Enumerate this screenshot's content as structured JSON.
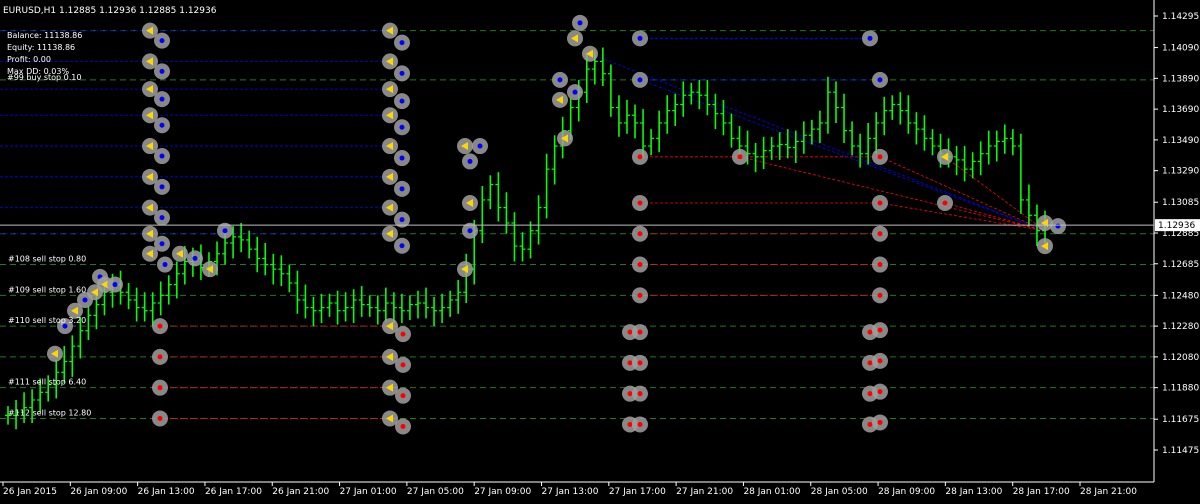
{
  "header": {
    "symbol": "EURUSD,H1",
    "quote": "1.12885 1.12936 1.12885 1.12936"
  },
  "account": {
    "balance": "Balance: 11138.86",
    "equity": "Equity: 11138.86",
    "profit": "Profit: 0.00",
    "max_dd": "Max DD: 0.03%",
    "order_note": "#99 buy stop 0.10"
  },
  "colors": {
    "background": "#000000",
    "candle": "#00ff00",
    "buy": "#0000ff",
    "sell": "#ff0000",
    "level_line": "#1e7a1e",
    "bid_line": "#c0c0c0",
    "marker_ring": "#a0a0a0",
    "axis_text": "#ffffff"
  },
  "chart_data": {
    "type": "candlestick",
    "symbol": "EURUSD",
    "timeframe": "H1",
    "current_price": 1.12936,
    "current_price_label": "1.12936",
    "ylim": [
      1.11475,
      1.14295
    ],
    "y_ticks": [
      "1.14295",
      "1.14090",
      "1.13890",
      "1.13690",
      "1.13490",
      "1.13290",
      "1.13085",
      "1.12885",
      "1.12685",
      "1.12480",
      "1.12280",
      "1.12080",
      "1.11880",
      "1.11675",
      "1.11475"
    ],
    "x_ticks": [
      "26 Jan 2015",
      "26 Jan 09:00",
      "26 Jan 13:00",
      "26 Jan 17:00",
      "26 Jan 21:00",
      "27 Jan 01:00",
      "27 Jan 05:00",
      "27 Jan 09:00",
      "27 Jan 13:00",
      "27 Jan 17:00",
      "27 Jan 21:00",
      "28 Jan 01:00",
      "28 Jan 05:00",
      "28 Jan 09:00",
      "28 Jan 13:00",
      "28 Jan 17:00",
      "28 Jan 21:00"
    ],
    "grid_levels": [
      1.142,
      1.1388,
      1.1288,
      1.1268,
      1.1248,
      1.1228,
      1.1208,
      1.1188,
      1.1168
    ],
    "candles_close": [
      1.117,
      1.1172,
      1.1175,
      1.118,
      1.1185,
      1.119,
      1.1198,
      1.1205,
      1.1215,
      1.1225,
      1.1235,
      1.1242,
      1.125,
      1.1255,
      1.125,
      1.1245,
      1.124,
      1.1238,
      1.1243,
      1.1248,
      1.1255,
      1.1262,
      1.127,
      1.1272,
      1.1266,
      1.127,
      1.1275,
      1.1282,
      1.1286,
      1.1284,
      1.1278,
      1.1272,
      1.1268,
      1.1265,
      1.1262,
      1.1256,
      1.1245,
      1.124,
      1.1238,
      1.124,
      1.1243,
      1.1238,
      1.124,
      1.1245,
      1.1242,
      1.124,
      1.1238,
      1.1243,
      1.124,
      1.1238,
      1.1242,
      1.1243,
      1.124,
      1.1238,
      1.124,
      1.1245,
      1.125,
      1.1265,
      1.129,
      1.131,
      1.132,
      1.1305,
      1.1295,
      1.128,
      1.1278,
      1.129,
      1.1305,
      1.133,
      1.1345,
      1.1355,
      1.137,
      1.138,
      1.1395,
      1.14,
      1.1392,
      1.137,
      1.136,
      1.1365,
      1.136,
      1.1345,
      1.135,
      1.136,
      1.1368,
      1.1372,
      1.1378,
      1.138,
      1.1378,
      1.1372,
      1.1366,
      1.136,
      1.135,
      1.1345,
      1.134,
      1.1338,
      1.1342,
      1.1345,
      1.1346,
      1.1344,
      1.1348,
      1.1352,
      1.1356,
      1.136,
      1.138,
      1.137,
      1.1355,
      1.1345,
      1.134,
      1.135,
      1.136,
      1.1368,
      1.1372,
      1.1368,
      1.136,
      1.1356,
      1.135,
      1.1345,
      1.134,
      1.1338,
      1.1336,
      1.133,
      1.1335,
      1.134,
      1.1345,
      1.1348,
      1.135,
      1.1345,
      1.131,
      1.13,
      1.129,
      1.1294
    ],
    "pending_order_labels": [
      {
        "text": "#108 sell stop 0.80",
        "price": 1.1268
      },
      {
        "text": "#109 sell stop 1.60",
        "price": 1.1248
      },
      {
        "text": "#110 sell stop 3.20",
        "price": 1.1228
      },
      {
        "text": "#111 sell stop 6.40",
        "price": 1.1188
      },
      {
        "text": "#112 sell stop 12.80",
        "price": 1.1168
      }
    ]
  }
}
